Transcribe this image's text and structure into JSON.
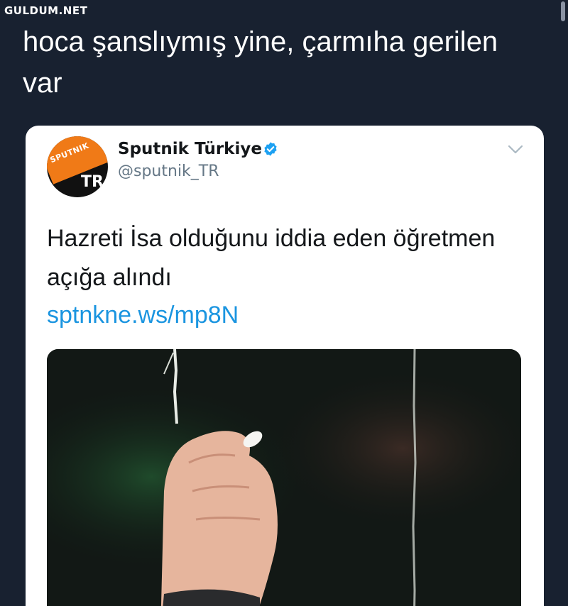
{
  "watermark": "GULDUM.NET",
  "caption": "hoca şanslıymış yine, çarmıha gerilen var",
  "tweet": {
    "account_name": "Sputnik Türkiye",
    "handle": "@sputnik_TR",
    "avatar_logo_text": "SPUTNIK",
    "avatar_region_text": "TR",
    "text": "Hazreti İsa olduğunu iddia eden öğretmen açığa alındı",
    "link": "sptnkne.ws/mp8N"
  },
  "colors": {
    "background": "#182130",
    "link": "#1b95e0",
    "verified": "#1da1f2",
    "brand_orange": "#f07a17"
  },
  "icons": {
    "verified": "verified-badge-icon",
    "menu": "chevron-down-icon"
  }
}
